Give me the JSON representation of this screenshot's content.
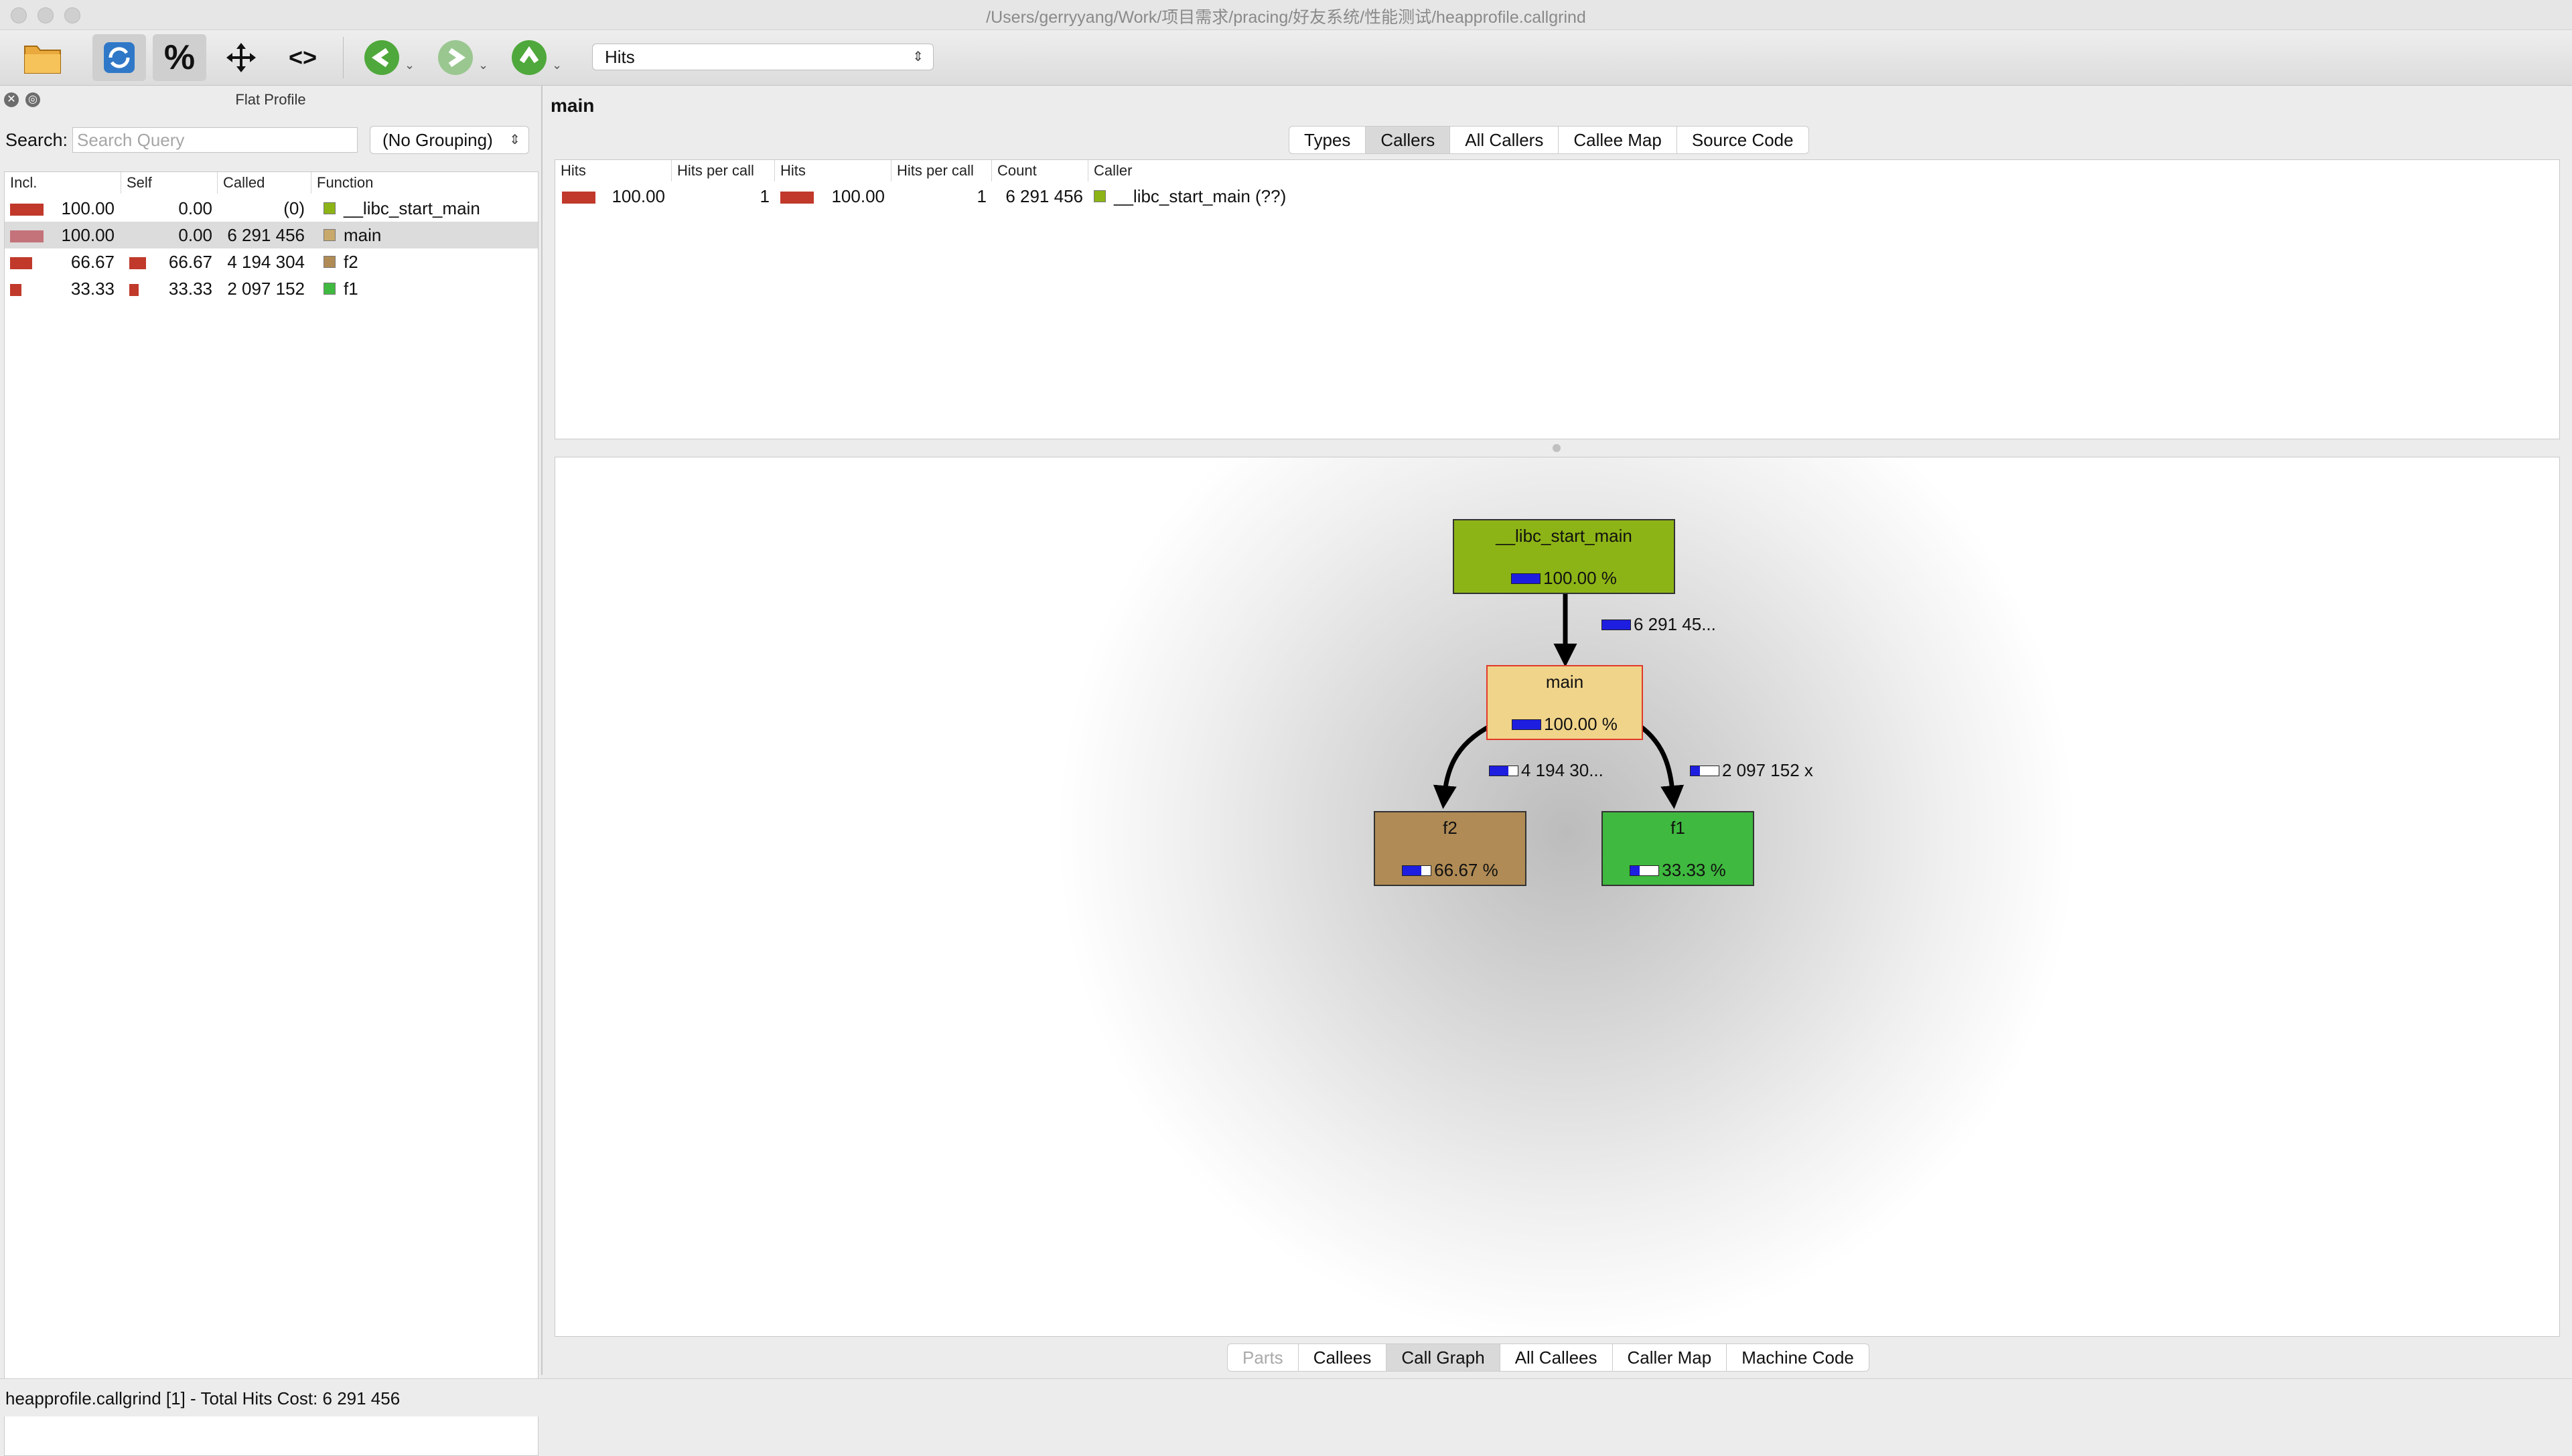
{
  "window": {
    "title": "/Users/gerryyang/Work/项目需求/pracing/好友系统/性能测试/heapprofile.callgrind"
  },
  "toolbar": {
    "icons": [
      "open-folder-icon",
      "reload-icon",
      "percent-icon",
      "move-icon",
      "code-icon",
      "back-icon",
      "forward-icon",
      "up-icon"
    ],
    "event_type": "Hits"
  },
  "flat_profile": {
    "title": "Flat Profile",
    "search_label": "Search:",
    "search_placeholder": "Search Query",
    "grouping": "(No Grouping)",
    "columns": [
      "Incl.",
      "Self",
      "Called",
      "Function"
    ],
    "rows": [
      {
        "incl": "100.00",
        "self": "0.00",
        "called": "(0)",
        "function": "__libc_start_main",
        "color": "#8db416",
        "incl_frac": 1.0,
        "self_frac": 0.0
      },
      {
        "incl": "100.00",
        "self": "0.00",
        "called": "6 291 456",
        "function": "main",
        "color": "#c9a96b",
        "incl_frac": 1.0,
        "self_frac": 0.0
      },
      {
        "incl": "66.67",
        "self": "66.67",
        "called": "4 194 304",
        "function": "f2",
        "color": "#b08b55",
        "incl_frac": 0.6667,
        "self_frac": 0.6667
      },
      {
        "incl": "33.33",
        "self": "33.33",
        "called": "2 097 152",
        "function": "f1",
        "color": "#3fb93f",
        "incl_frac": 0.3333,
        "self_frac": 0.3333
      }
    ]
  },
  "main": {
    "function_name": "main",
    "top_tabs": [
      "Types",
      "Callers",
      "All Callers",
      "Callee Map",
      "Source Code"
    ],
    "top_active": "Callers",
    "callers": {
      "columns": [
        "Hits",
        "Hits per call",
        "Hits",
        "Hits per call",
        "Count",
        "Caller"
      ],
      "rows": [
        {
          "hits": "100.00",
          "hits_per_call": "1",
          "hits2": "100.00",
          "hits_per_call2": "1",
          "count": "6 291 456",
          "caller": "__libc_start_main (??)",
          "color": "#8db416"
        }
      ]
    },
    "graph": {
      "nodes": [
        {
          "name": "__libc_start_main",
          "percent": "100.00 %",
          "fill_frac": 1.0,
          "color": "#8db416"
        },
        {
          "name": "main",
          "percent": "100.00 %",
          "fill_frac": 1.0,
          "color": "#f0d48a"
        },
        {
          "name": "f2",
          "percent": "66.67 %",
          "fill_frac": 0.6667,
          "color": "#b08b55"
        },
        {
          "name": "f1",
          "percent": "33.33 %",
          "fill_frac": 0.3333,
          "color": "#3fb93f"
        }
      ],
      "edges": [
        {
          "label": "6 291 45...",
          "fill_frac": 1.0
        },
        {
          "label": "4 194 30...",
          "fill_frac": 0.6667
        },
        {
          "label": "2 097 152 x",
          "fill_frac": 0.3333
        }
      ]
    },
    "bottom_tabs": [
      "Parts",
      "Callees",
      "Call Graph",
      "All Callees",
      "Caller Map",
      "Machine Code"
    ],
    "bottom_active": "Call Graph"
  },
  "status": {
    "text": "heapprofile.callgrind [1] - Total Hits Cost: 6 291 456"
  }
}
